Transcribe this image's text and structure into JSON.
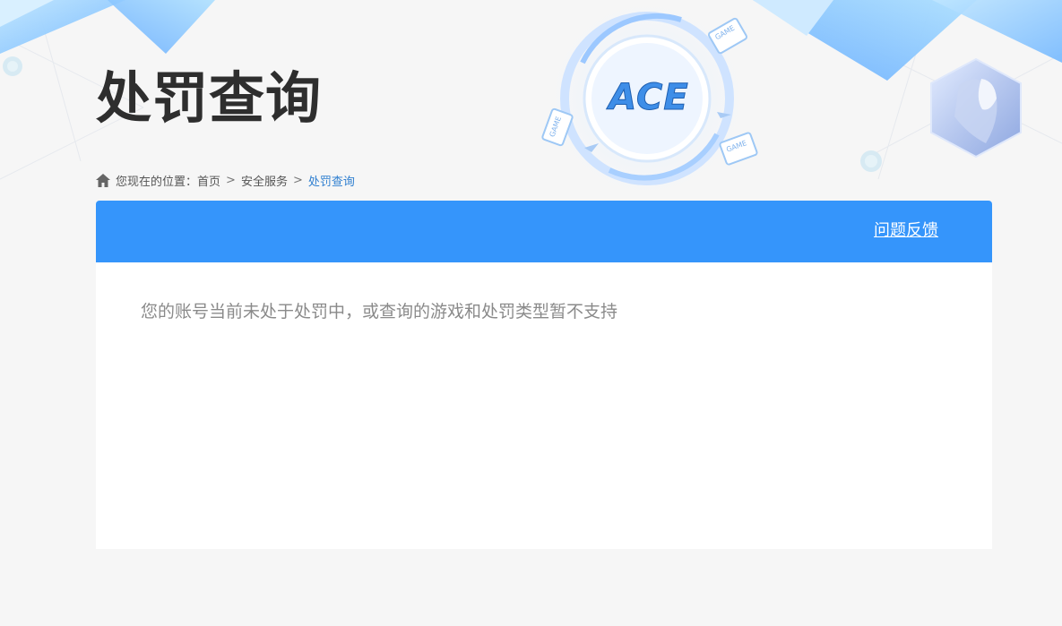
{
  "header": {
    "title": "处罚查询",
    "logo_text": "ACE",
    "game_labels": [
      "GAME",
      "GAME",
      "GAME"
    ]
  },
  "breadcrumb": {
    "prefix": "您现在的位置：",
    "items": [
      "首页",
      "安全服务",
      "处罚查询"
    ],
    "separator": ">"
  },
  "panel": {
    "feedback_label": "问题反馈",
    "message": "您的账号当前未处于处罚中，或查询的游戏和处罚类型暂不支持"
  },
  "colors": {
    "accent": "#3595fb",
    "breadcrumb_current": "#2f7fd0",
    "title": "#2e2e2e",
    "message": "#8a8a8a",
    "background": "#f6f6f6"
  }
}
